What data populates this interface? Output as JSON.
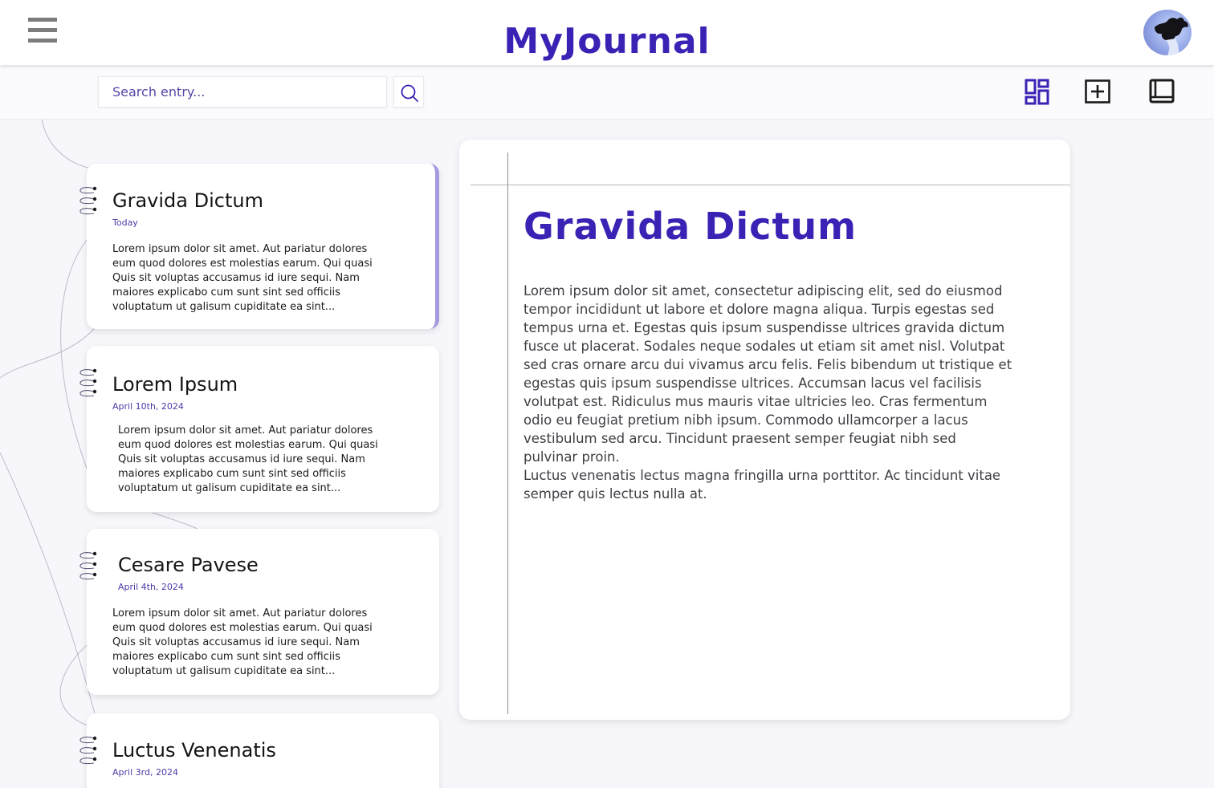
{
  "header": {
    "title": "MyJournal",
    "menu_icon": "hamburger-menu-icon",
    "avatar_icon": "user-avatar"
  },
  "toolbar": {
    "search_placeholder": "Search entry...",
    "search_value": "",
    "search_icon": "search-icon",
    "icons": [
      "dashboard-grid-icon",
      "add-entry-icon",
      "book-icon"
    ]
  },
  "entries": [
    {
      "title": "Gravida Dictum",
      "date": "Today",
      "excerpt": "Lorem ipsum dolor sit amet. Aut pariatur dolores eum quod dolores est molestias earum. Qui quasi Quis sit voluptas accusamus id iure sequi. Nam maiores explicabo cum sunt sint sed officiis voluptatum ut galisum cupiditate ea sint..."
    },
    {
      "title": "Lorem Ipsum",
      "date": "April 10th, 2024",
      "excerpt": "Lorem ipsum dolor sit amet. Aut pariatur dolores eum quod dolores est molestias earum. Qui quasi Quis sit voluptas accusamus id iure sequi. Nam maiores explicabo cum sunt sint sed officiis voluptatum ut galisum cupiditate ea sint..."
    },
    {
      "title": "Cesare Pavese",
      "date": "April 4th, 2024",
      "excerpt": "Lorem ipsum dolor sit amet. Aut pariatur dolores eum quod dolores est molestias earum. Qui quasi Quis sit voluptas accusamus id iure sequi. Nam maiores explicabo cum sunt sint sed officiis voluptatum ut galisum cupiditate ea sint..."
    },
    {
      "title": "Luctus Venenatis",
      "date": "April 3rd, 2024",
      "excerpt": ""
    }
  ],
  "detail": {
    "title": "Gravida Dictum",
    "paragraphs": [
      "Lorem ipsum dolor sit amet, consectetur adipiscing elit, sed do eiusmod tempor incididunt ut labore et dolore magna aliqua. Turpis egestas sed tempus urna et. Egestas quis ipsum suspendisse ultrices gravida dictum fusce ut placerat. Sodales neque sodales ut etiam sit amet nisl. Volutpat sed cras ornare arcu dui vivamus arcu felis. Felis bibendum ut tristique et egestas quis ipsum suspendisse ultrices. Accumsan lacus vel facilisis volutpat est. Ridiculus mus mauris vitae ultricies leo. Cras fermentum odio eu feugiat pretium nibh ipsum. Commodo ullamcorper a lacus vestibulum sed arcu. Tincidunt praesent semper feugiat nibh sed pulvinar proin.",
      "Luctus venenatis lectus magna fringilla urna porttitor. Ac tincidunt vitae semper quis lectus nulla at."
    ]
  },
  "colors": {
    "brand": "#3a22b5",
    "page_background": "#f7f7fb",
    "active_marker": "#a79ae0"
  }
}
